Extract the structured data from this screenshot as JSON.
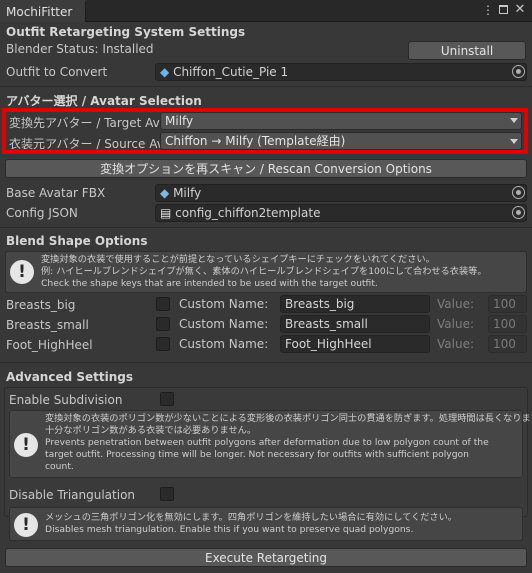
{
  "window": {
    "tab_title": "MochiFitter",
    "menu_icon": "kebab-icon",
    "maximize_icon": "maximize-icon",
    "close_icon": "close-icon"
  },
  "system": {
    "header": "Outfit Retargeting System Settings",
    "blender_status": "Blender Status: Installed",
    "uninstall_label": "Uninstall",
    "outfit_label": "Outfit to Convert",
    "outfit_value": "Chiffon_Cutie_Pie 1"
  },
  "avatar": {
    "header": "アバター選択 / Avatar Selection",
    "target_label": "変換先アバター / Target Avat",
    "target_value": "Milfy",
    "source_label": "衣装元アバター / Source Ava",
    "source_value": "Chiffon → Milfy (Template経由)",
    "rescan_label": "変換オプションを再スキャン / Rescan Conversion Options",
    "base_fbx_label": "Base Avatar FBX",
    "base_fbx_value": "Milfy",
    "config_label": "Config JSON",
    "config_value": "config_chiffon2template"
  },
  "blend": {
    "header": "Blend Shape Options",
    "help_lines": [
      "変換対象の衣装で使用することが前提となっているシェイプキーにチェックをいれてください。",
      "例: ハイヒールブレンドシェイプが無く、素体のハイヒールブレンドシェイプを100にして合わせる衣装等。",
      "Check the shape keys that are intended to be used with the target outfit."
    ],
    "custom_name_label": "Custom Name:",
    "value_label": "Value:",
    "rows": [
      {
        "name": "Breasts_big",
        "custom": "Breasts_big",
        "value": "100"
      },
      {
        "name": "Breasts_small",
        "custom": "Breasts_small",
        "value": "100"
      },
      {
        "name": "Foot_HighHeel",
        "custom": "Foot_HighHeel",
        "value": "100"
      }
    ]
  },
  "advanced": {
    "header": "Advanced Settings",
    "subdiv_label": "Enable Subdivision",
    "subdiv_help": [
      "変換対象の衣装のポリゴン数が少ないことによる変形後の衣装ポリゴン同士の貫通を防ぎます。処理時間は長くなります。",
      "十分なポリゴン数がある衣装では必要ありません。",
      "Prevents penetration between outfit polygons after deformation due to low polygon count of the",
      "target outfit. Processing time will be longer. Not necessary for outfits with sufficient polygon",
      "count."
    ],
    "tri_label": "Disable Triangulation",
    "tri_help": [
      "メッシュの三角ポリゴン化を無効にします。四角ポリゴンを維持したい場合に有効にしてください。",
      "Disables mesh triangulation. Enable this if you want to preserve quad polygons."
    ],
    "execute_label": "Execute Retargeting"
  },
  "colors": {
    "highlight": "#e00000",
    "background": "#383838"
  }
}
